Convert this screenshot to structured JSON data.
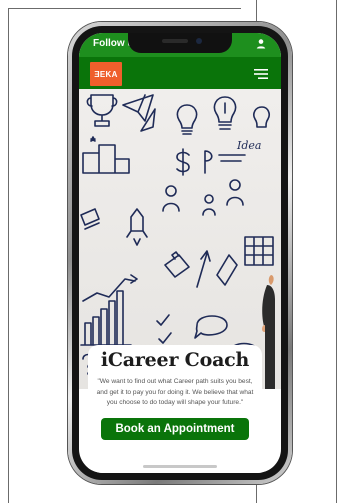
{
  "status_bar": {
    "text": "Follow u",
    "icon": "user-icon",
    "color": "#1e8f1e"
  },
  "nav": {
    "logo_text": "ƎEKA",
    "logo_color": "#ef5f2c",
    "background": "#0a740a",
    "menu_icon": "hamburger-menu-icon"
  },
  "hero": {
    "doodle_text": "Idea",
    "doodle_color": "#1f2b57"
  },
  "card": {
    "title": "iCareer Coach",
    "quote": "\"We want to find out what Career path suits you best, and get it to pay you for doing it. We believe that what you choose to do today will shape your future.\"",
    "button_label": "Book an Appointment",
    "button_color": "#0a740a"
  }
}
